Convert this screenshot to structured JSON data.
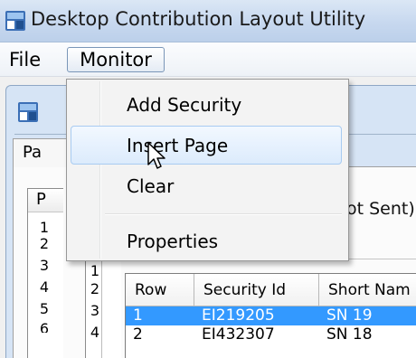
{
  "window": {
    "title": "Desktop Contribution Layout Utility",
    "app_icon": "app-window-icon"
  },
  "menubar": {
    "items": [
      "File",
      "Monitor"
    ],
    "active": "Monitor"
  },
  "monitor_menu": {
    "items": [
      "Add Security",
      "Insert Page",
      "Clear",
      "Properties"
    ],
    "hovered": "Insert Page"
  },
  "background": {
    "tab_label": "Pa",
    "left_list_header": "P",
    "left_list_numbers": [
      "1",
      "2",
      "3",
      "4",
      "5",
      "6"
    ],
    "mid_list_numbers": [
      "1",
      "2",
      "3",
      "4"
    ],
    "status_fragment": "ot Sent)"
  },
  "grid": {
    "columns": [
      "Row",
      "Security Id",
      "Short Nam"
    ],
    "rows": [
      {
        "row": "1",
        "security_id": "EI219205",
        "short_name": "SN 19",
        "selected": true
      },
      {
        "row": "2",
        "security_id": "EI432307",
        "short_name": "SN 18",
        "selected": false
      }
    ]
  },
  "colors": {
    "selection": "#3399ff",
    "menu_highlight_border": "#a8cbf1",
    "titlebar": "#c7d8ef"
  }
}
